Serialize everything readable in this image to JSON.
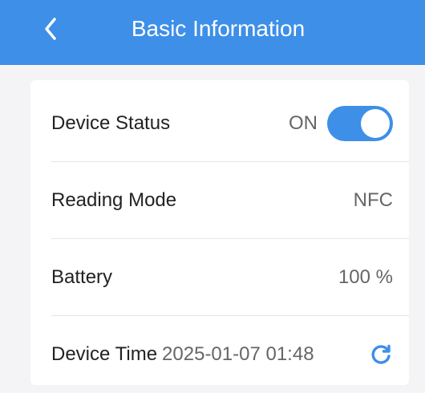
{
  "header": {
    "title": "Basic Information",
    "back_icon": "chevron-left-icon",
    "background_color": "#3d8fe8"
  },
  "rows": {
    "device_status": {
      "label": "Device Status",
      "value": "ON",
      "toggle_on": true
    },
    "reading_mode": {
      "label": "Reading Mode",
      "value": "NFC"
    },
    "battery": {
      "label": "Battery",
      "value": "100 %"
    },
    "device_time": {
      "label": "Device Time",
      "value": "2025-01-07 01:48",
      "refresh_icon": "refresh-icon"
    }
  },
  "colors": {
    "accent": "#3d8fe8",
    "background": "#f4f4f6",
    "card": "#ffffff"
  }
}
